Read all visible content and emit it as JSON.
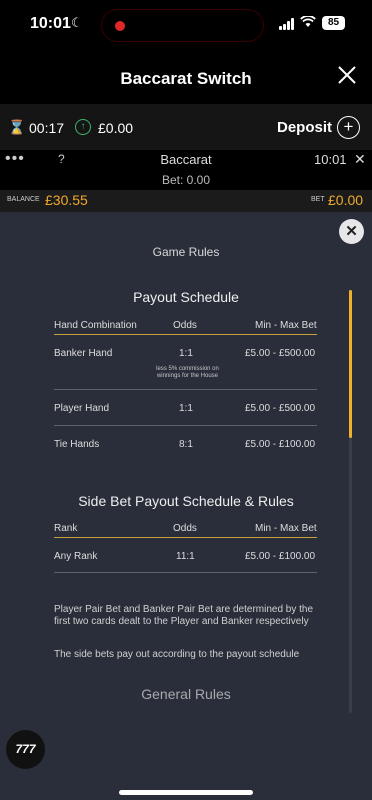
{
  "status": {
    "time": "10:01",
    "battery": "85"
  },
  "header": {
    "title": "Baccarat Switch"
  },
  "wallet": {
    "timer": "00:17",
    "amount": "£0.00",
    "deposit_label": "Deposit"
  },
  "game": {
    "name": "Baccarat",
    "bet_line": "Bet: 0.00",
    "time": "10:01",
    "help": "?"
  },
  "balance": {
    "label": "BALANCE",
    "value": "£30.55",
    "bet_label": "BET",
    "bet_value": "£0.00"
  },
  "rules": {
    "title": "Game Rules",
    "payout": {
      "heading": "Payout Schedule",
      "columns": [
        "Hand Combination",
        "Odds",
        "Min - Max Bet"
      ],
      "rows": [
        {
          "hand": "Banker Hand",
          "odds": "1:1",
          "range": "£5.00 - £500.00"
        },
        {
          "hand": "Player Hand",
          "odds": "1:1",
          "range": "£5.00 - £500.00"
        },
        {
          "hand": "Tie Hands",
          "odds": "8:1",
          "range": "£5.00 - £100.00"
        }
      ],
      "banker_note": "less 5% commission on winnings for the House"
    },
    "side": {
      "heading": "Side Bet Payout Schedule & Rules",
      "columns": [
        "Rank",
        "Odds",
        "Min - Max Bet"
      ],
      "rows": [
        {
          "hand": "Any Rank",
          "odds": "11:1",
          "range": "£5.00 - £100.00"
        }
      ]
    },
    "para1": "Player Pair Bet and Banker Pair Bet are determined by the first two cards dealt to the Player and Banker respectively",
    "para2": "The side bets pay out according to the payout schedule",
    "general": "General Rules"
  },
  "logo_text": "777"
}
